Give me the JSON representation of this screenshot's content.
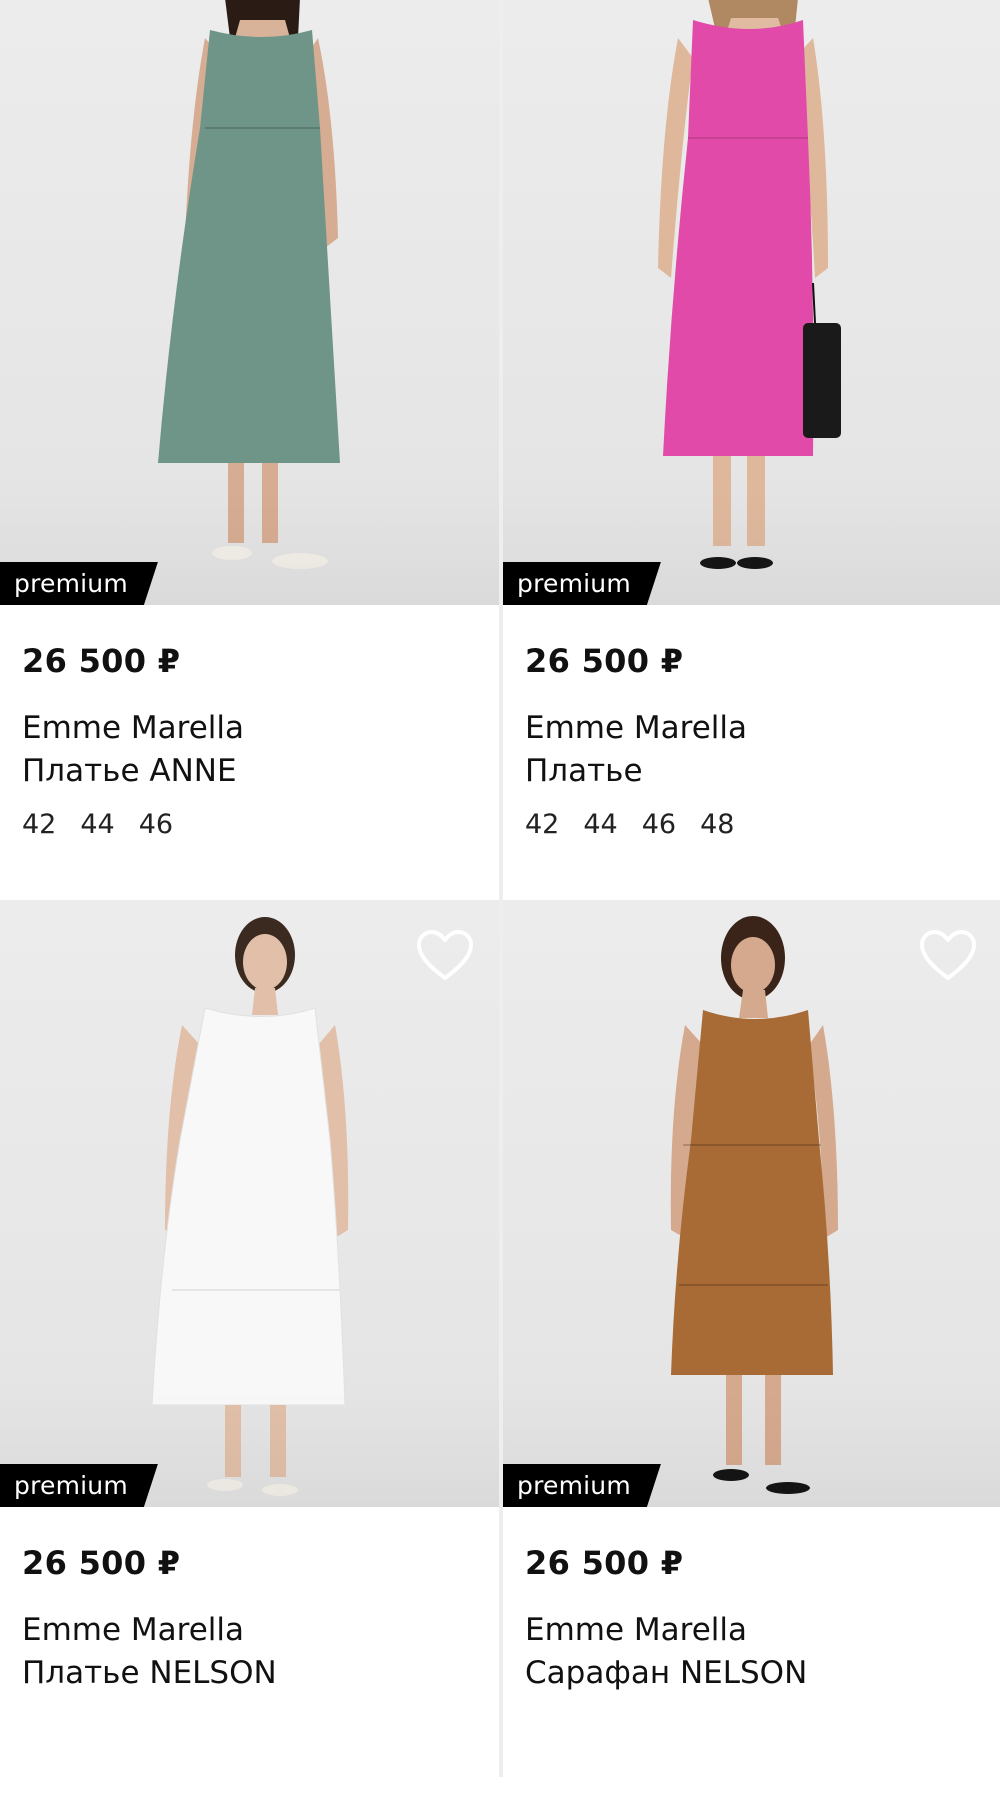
{
  "currency": "₽",
  "products": [
    {
      "badge": "premium",
      "price": "26 500 ₽",
      "brand": "Emme Marella",
      "title": "Платье ANNE",
      "sizes": [
        "42",
        "44",
        "46"
      ],
      "dress_color": "#6f9589",
      "has_favorite": false
    },
    {
      "badge": "premium",
      "price": "26 500 ₽",
      "brand": "Emme Marella",
      "title": "Платье",
      "sizes": [
        "42",
        "44",
        "46",
        "48"
      ],
      "dress_color": "#e14aa8",
      "has_favorite": false
    },
    {
      "badge": "premium",
      "price": "26 500 ₽",
      "brand": "Emme Marella",
      "title": "Платье NELSON",
      "sizes": [],
      "dress_color": "#f8f8f8",
      "has_favorite": true,
      "favorite_icon": "heart-outline-icon"
    },
    {
      "badge": "premium",
      "price": "26 500 ₽",
      "brand": "Emme Marella",
      "title": "Сарафан NELSON",
      "sizes": [],
      "dress_color": "#a86b35",
      "has_favorite": true,
      "favorite_icon": "heart-outline-icon"
    }
  ]
}
